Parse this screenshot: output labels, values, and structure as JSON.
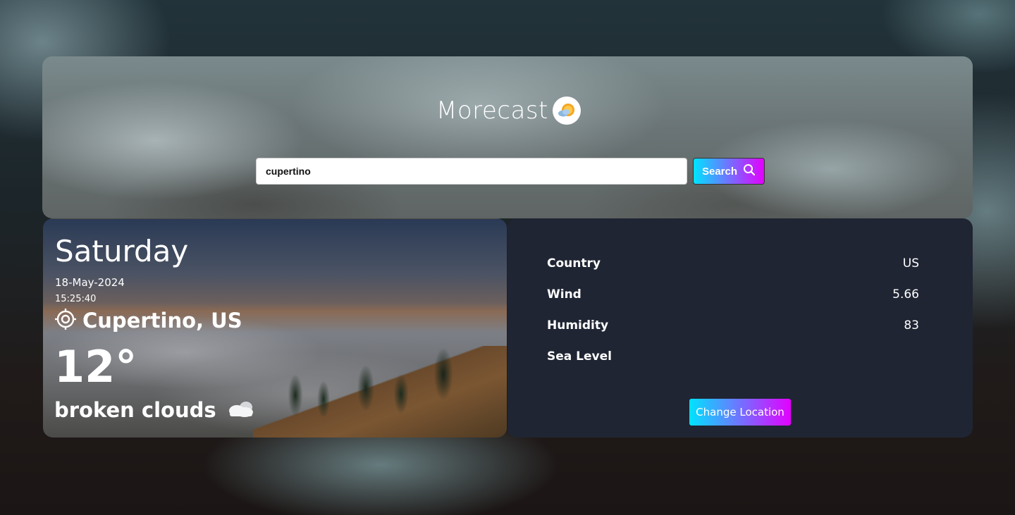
{
  "header": {
    "brand_name": "Morecast",
    "logo_icon": "sun-cloud-icon"
  },
  "search": {
    "value": "cupertino",
    "button_label": "Search",
    "button_icon": "search-icon"
  },
  "weather": {
    "day": "Saturday",
    "date": "18-May-2024",
    "time": "15:25:40",
    "location": "Cupertino, US",
    "location_icon": "location-target-icon",
    "temperature": "12°",
    "condition": "broken clouds",
    "condition_icon": "cloud-icon"
  },
  "details": {
    "rows": [
      {
        "label": "Country",
        "value": "US"
      },
      {
        "label": "Wind",
        "value": "5.66"
      },
      {
        "label": "Humidity",
        "value": "83"
      },
      {
        "label": "Sea Level",
        "value": ""
      }
    ],
    "change_location_label": "Change Location"
  },
  "colors": {
    "accent_gradient_start": "#00e3ff",
    "accent_gradient_end": "#e400ff",
    "details_background": "#1f2533"
  }
}
